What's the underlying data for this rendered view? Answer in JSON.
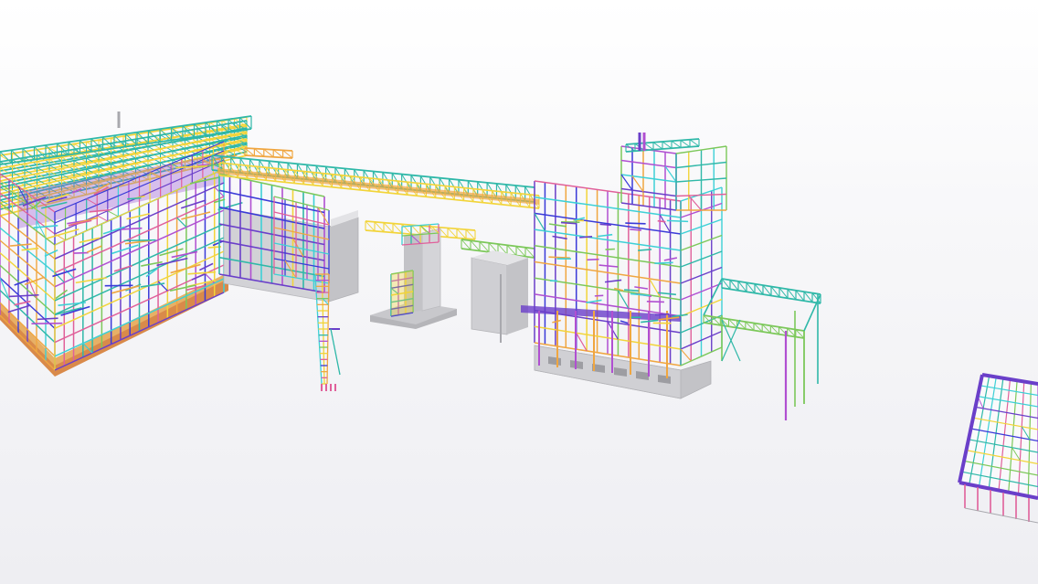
{
  "viewer": {
    "mode": "3d-model-view",
    "background_top": "#ffffff",
    "background_bottom": "#eeeef2"
  },
  "palette": {
    "magenta": "#b04fd1",
    "violet": "#6a3fc9",
    "navy": "#3a3ad8",
    "teal": "#2fb8a8",
    "cyan": "#3dd0d6",
    "yellow": "#f2d43a",
    "orange": "#f0a640",
    "green": "#7cc85a",
    "pink": "#e0609a",
    "concrete": "#c3c3c7",
    "concrete_dark": "#a9a9ae",
    "floor": "#d98a4a"
  },
  "objects": [
    {
      "name": "main-hall-structure"
    },
    {
      "name": "conveyor-bridge"
    },
    {
      "name": "transfer-tower"
    },
    {
      "name": "concrete-bunker-left"
    },
    {
      "name": "concrete-pedestal-center"
    },
    {
      "name": "concrete-bunker-right"
    },
    {
      "name": "process-building"
    },
    {
      "name": "canopy-structure"
    },
    {
      "name": "detached-frame"
    },
    {
      "name": "lattice-column"
    }
  ]
}
